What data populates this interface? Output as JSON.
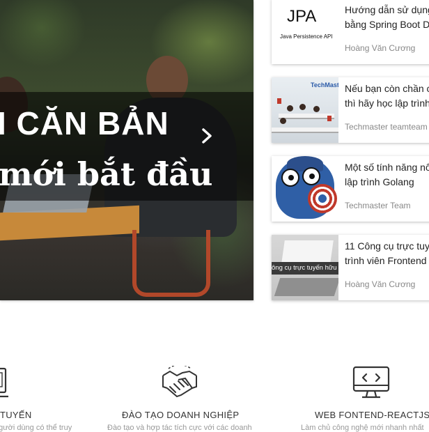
{
  "hero": {
    "line1": "I CĂN BẢN",
    "line2": "mới bắt đầu",
    "next_icon": "chevron-right-icon"
  },
  "articles": [
    {
      "thumb_big": "JPA",
      "thumb_small": "Java Persistence API",
      "title_line1": "Hướng dẫn sử dụng",
      "title_line2": "bằng Spring Boot D",
      "author": "Hoàng Văn Cương"
    },
    {
      "thumb_logo": "TechMaster",
      "title_line1": "Nếu bạn còn chần c",
      "title_line2": "thì hãy học lập trình",
      "author": "Techmaster teamteam"
    },
    {
      "title_line1": "Một số tính năng nổ",
      "title_line2": "lập trình Golang",
      "author": "Techmaster Team"
    },
    {
      "thumb_label": "ông cụ trực tuyến hữu",
      "title_line1": "11 Công cụ trực tuy",
      "title_line2": "trình viên Frontend",
      "author": "Hoàng Văn Cương"
    }
  ],
  "services": [
    {
      "icon": "laptop-icon",
      "name": "TUYẾN",
      "desc": "người dùng có thể truy"
    },
    {
      "icon": "handshake-icon",
      "name": "ĐÀO TẠO DOANH NGHIỆP",
      "desc": "Đào tạo và hợp tác tích cực với các doanh"
    },
    {
      "icon": "code-monitor-icon",
      "name": "WEB FONTEND-REACTJS",
      "desc": "Làm chủ công nghệ mới nhanh nhất"
    }
  ],
  "colors": {
    "accent_red": "#c0392b",
    "text_gray": "#888888"
  }
}
